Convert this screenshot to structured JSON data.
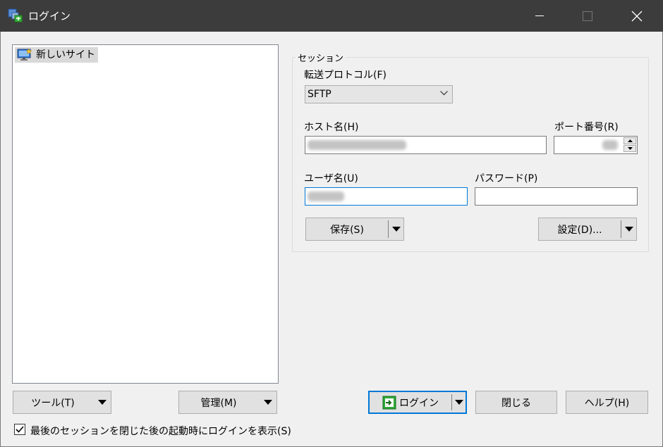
{
  "window": {
    "title": "ログイン",
    "minimize_icon": "minimize-icon",
    "maximize_icon": "maximize-icon",
    "close_icon": "close-icon"
  },
  "site_tree": {
    "items": [
      {
        "label": "新しいサイト",
        "icon": "new-site-monitor-icon",
        "selected": true
      }
    ]
  },
  "left_buttons": {
    "tools": "ツール(T)",
    "manage": "管理(M)"
  },
  "session": {
    "legend": "セッション",
    "protocol_label": "転送プロトコル(F)",
    "protocol_value": "SFTP",
    "host_label": "ホスト名(H)",
    "port_label": "ポート番号(R)",
    "user_label": "ユーザ名(U)",
    "password_label": "パスワード(P)",
    "save_button": "保存(S)",
    "settings_button": "設定(D)..."
  },
  "bottom_buttons": {
    "login": "ログイン",
    "close": "閉じる",
    "help": "ヘルプ(H)"
  },
  "checkbox": {
    "label": "最後のセッションを閉じた後の起動時にログインを表示(S)",
    "checked": true
  },
  "colors": {
    "titlebar": "#3c3c3c",
    "window_bg": "#f0f0f0",
    "focus_border": "#0078d7",
    "selection": "#d9d9d9"
  }
}
